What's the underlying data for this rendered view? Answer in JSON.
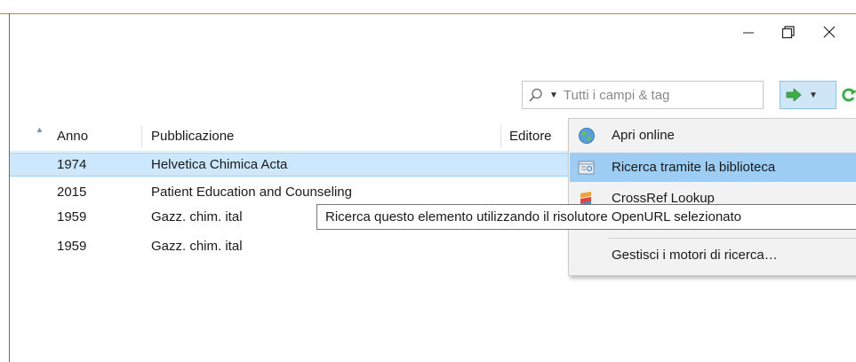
{
  "window_controls": {
    "minimize": "minimize",
    "restore": "restore",
    "close": "close"
  },
  "search": {
    "placeholder": "Tutti i campi & tag",
    "value": ""
  },
  "icons": {
    "search": "magnifier-icon",
    "locate": "green-arrow-icon",
    "sync": "sync-icon",
    "open_online": "globe-icon",
    "library_lookup": "library-icon",
    "crossref": "crossref-icon"
  },
  "table": {
    "columns": {
      "sort": "▲",
      "year": "Anno",
      "publication": "Pubblicazione",
      "publisher": "Editore"
    },
    "rows": [
      {
        "year": "1974",
        "publication": "Helvetica Chimica Acta",
        "selected": true
      },
      {
        "year": "2015",
        "publication": "Patient Education and Counseling",
        "selected": false
      },
      {
        "year": "1959",
        "publication": "Gazz. chim. ital",
        "selected": false
      },
      {
        "year": "1959",
        "publication": "Gazz. chim. ital",
        "selected": false
      }
    ]
  },
  "locate_menu": {
    "items": [
      {
        "label": "Apri online",
        "icon": "globe-icon",
        "highlighted": false
      },
      {
        "label": "Ricerca tramite la biblioteca",
        "icon": "library-icon",
        "highlighted": true
      },
      {
        "label": "CrossRef Lookup",
        "icon": "crossref-icon",
        "highlighted": false
      },
      {
        "label": "Gestisci i motori di ricerca…",
        "icon": "",
        "highlighted": false
      }
    ]
  },
  "tooltip": {
    "text": "Ricerca questo elemento utilizzando il risolutore OpenURL selezionato"
  },
  "colors": {
    "selection": "#cce8ff",
    "menu_highlight": "#9dcdf2",
    "locate_button": "#cfe6f7",
    "accent_green": "#4caf50"
  }
}
